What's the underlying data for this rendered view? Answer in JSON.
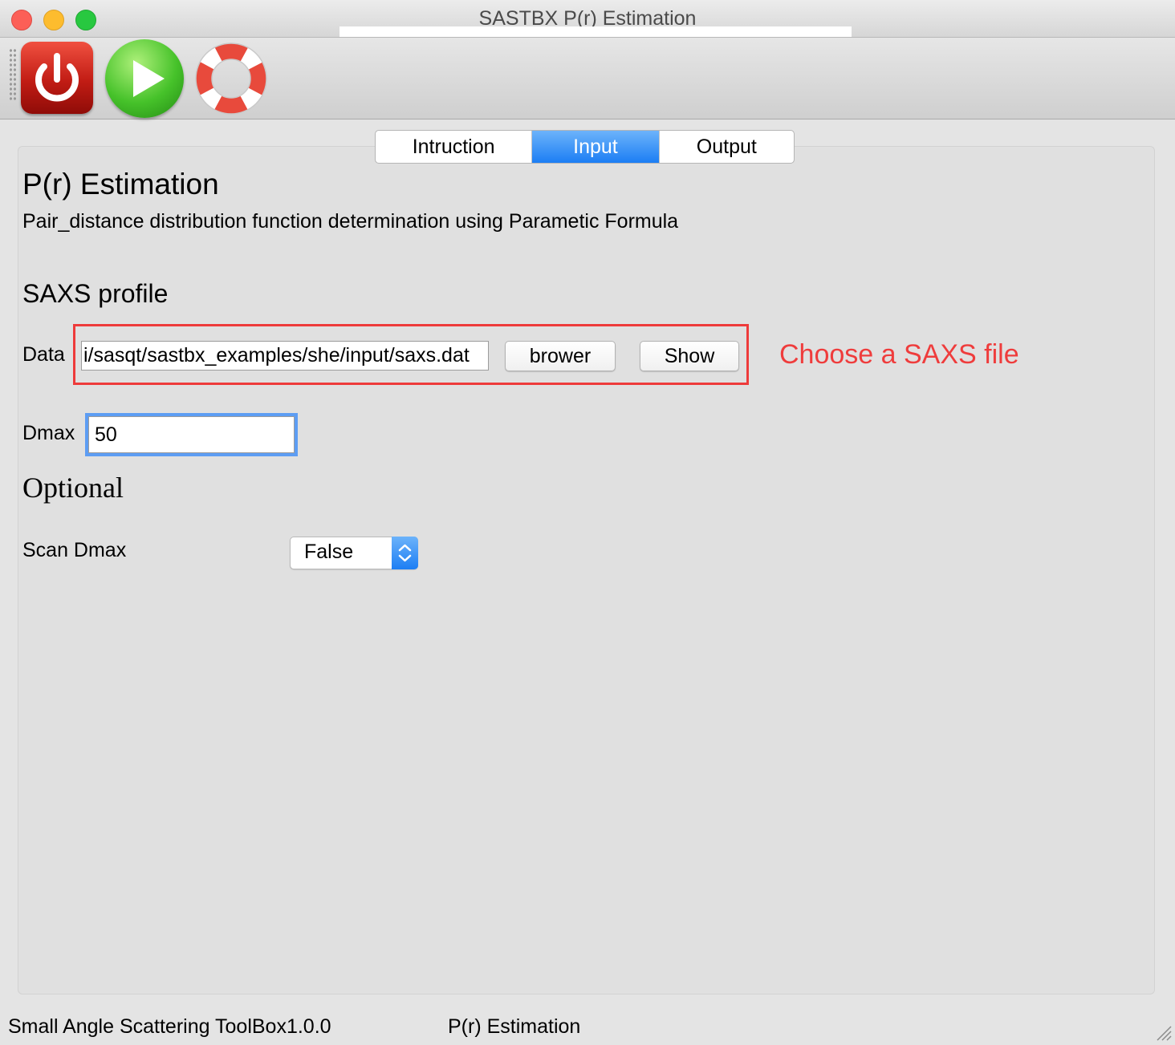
{
  "window": {
    "title": "SASTBX P(r) Estimation"
  },
  "toolbar": {
    "buttons": [
      {
        "icon": "power-icon",
        "color": "#d0201a"
      },
      {
        "icon": "play-icon",
        "color": "#3db82a"
      },
      {
        "icon": "lifebuoy-icon",
        "color": "#e84a3c"
      }
    ]
  },
  "tabs": [
    {
      "label": "Intruction",
      "active": false
    },
    {
      "label": "Input",
      "active": true
    },
    {
      "label": "Output",
      "active": false
    }
  ],
  "main": {
    "title": "P(r) Estimation",
    "subtitle": "Pair_distance distribution function determination using Parametic Formula",
    "saxs_section": "SAXS profile",
    "data_label": "Data",
    "data_value": "i/sasqt/sastbx_examples/she/input/saxs.dat",
    "brower_label": "brower",
    "show_label": "Show",
    "annotation": "Choose a SAXS file",
    "dmax_label": "Dmax",
    "dmax_value": "50",
    "optional_title": "Optional",
    "scan_label": "Scan Dmax",
    "scan_value": "False"
  },
  "status": {
    "left": "Small Angle Scattering ToolBox1.0.0",
    "right": "P(r) Estimation"
  },
  "colors": {
    "accent": "#1c7ef4",
    "annotation": "#ef3c3c",
    "focus": "#5d9df3"
  }
}
